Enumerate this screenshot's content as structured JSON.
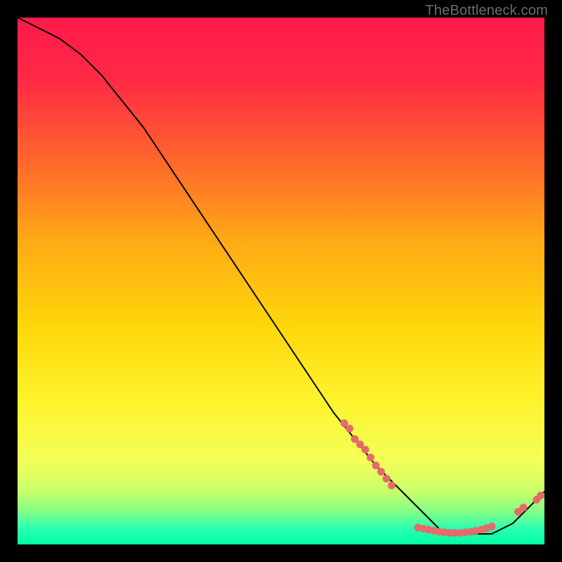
{
  "watermark": "TheBottleneck.com",
  "chart_data": {
    "type": "line",
    "title": "",
    "xlabel": "",
    "ylabel": "",
    "xlim": [
      0,
      100
    ],
    "ylim": [
      0,
      100
    ],
    "grid": false,
    "series": [
      {
        "name": "curve",
        "color": "#000000",
        "x": [
          0,
          4,
          8,
          12,
          16,
          20,
          24,
          28,
          32,
          36,
          40,
          44,
          48,
          52,
          56,
          60,
          64,
          68,
          72,
          76,
          78,
          80,
          82,
          84,
          86,
          88,
          90,
          92,
          94,
          96,
          98,
          100
        ],
        "y": [
          100,
          98,
          96,
          93,
          89,
          84,
          79,
          73,
          67,
          61,
          55,
          49,
          43,
          37,
          31,
          25,
          20,
          15,
          11,
          7,
          5,
          3,
          2,
          2,
          2,
          2,
          2,
          3,
          4,
          6,
          8,
          10
        ]
      }
    ],
    "dot_clusters": [
      {
        "name": "mid-drop-dots",
        "color": "#e46b6b",
        "points": [
          [
            62,
            23
          ],
          [
            63,
            22
          ],
          [
            64,
            20
          ],
          [
            65,
            19
          ],
          [
            66,
            18
          ],
          [
            67,
            16.5
          ],
          [
            68,
            15
          ],
          [
            69,
            13.8
          ],
          [
            70,
            12.5
          ],
          [
            71,
            11.2
          ]
        ]
      },
      {
        "name": "valley-dots",
        "color": "#e46b6b",
        "points": [
          [
            76,
            3.2
          ],
          [
            77,
            3.0
          ],
          [
            78,
            2.8
          ],
          [
            79,
            2.6
          ],
          [
            80,
            2.4
          ],
          [
            81,
            2.3
          ],
          [
            82,
            2.2
          ],
          [
            83,
            2.2
          ],
          [
            84,
            2.2
          ],
          [
            85,
            2.3
          ],
          [
            86,
            2.4
          ],
          [
            87,
            2.6
          ],
          [
            88,
            2.8
          ],
          [
            89,
            3.1
          ],
          [
            90,
            3.4
          ]
        ]
      },
      {
        "name": "right-rise-dots",
        "color": "#e46b6b",
        "points": [
          [
            95,
            6.2
          ],
          [
            96,
            7.0
          ],
          [
            98.5,
            8.5
          ],
          [
            99.3,
            9.3
          ]
        ]
      }
    ],
    "gradient_stops": [
      {
        "offset": 0.0,
        "color": "#ff1a4c"
      },
      {
        "offset": 0.12,
        "color": "#ff2a44"
      },
      {
        "offset": 0.28,
        "color": "#ff6a2a"
      },
      {
        "offset": 0.42,
        "color": "#ffa816"
      },
      {
        "offset": 0.58,
        "color": "#ffd60a"
      },
      {
        "offset": 0.72,
        "color": "#fff22a"
      },
      {
        "offset": 0.84,
        "color": "#f4ff58"
      },
      {
        "offset": 0.9,
        "color": "#c8ff6a"
      },
      {
        "offset": 0.94,
        "color": "#7dff8a"
      },
      {
        "offset": 0.97,
        "color": "#2affb2"
      },
      {
        "offset": 1.0,
        "color": "#00ffa0"
      }
    ]
  }
}
